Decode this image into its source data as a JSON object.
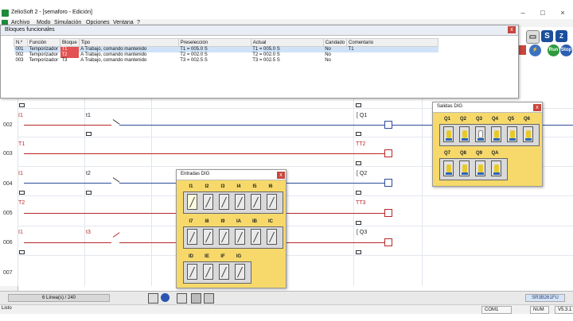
{
  "window": {
    "title": "ZelioSoft 2 - [semaforo - Edición]",
    "min": "–",
    "max": "□",
    "close": "×"
  },
  "menu": [
    "Archivo",
    "Modo",
    "Simulación",
    "Opciones",
    "Ventana",
    "?"
  ],
  "toolbar": {
    "s_btn": "S",
    "run": "Run",
    "stop": "Stop",
    "left_tab": "inte",
    "left_tab2": "Ne"
  },
  "fb": {
    "title": "Bloques funcionales",
    "close": "x",
    "columns": [
      "N.º",
      "Función",
      "Bloque",
      "Tipo",
      "Preselección",
      "Actual",
      "Candado",
      "Comentario"
    ],
    "rows": [
      [
        "001",
        "Temporizador",
        "T1",
        "A",
        "Trabajo, comando mantenido",
        "T1 = 005.0 S",
        "T1 = 005.0 S",
        "No",
        "T1"
      ],
      [
        "002",
        "Temporizador",
        "T2",
        "A",
        "Trabajo, comando mantenido",
        "T2 = 002.0 S",
        "T2 = 002.0 S",
        "No",
        ""
      ],
      [
        "003",
        "Temporizador",
        "T3",
        "A",
        "Trabajo, comando mantenido",
        "T3 = 002.5 S",
        "T3 = 002.5 S",
        "No",
        ""
      ]
    ]
  },
  "rows": [
    "001",
    "002",
    "003",
    "004",
    "005",
    "006",
    "007"
  ],
  "ladder": {
    "i1a": "I1",
    "t1": "t1",
    "q1": "[ Q1",
    "t1b": "T1",
    "tt2": "TT2",
    "i1b": "I1",
    "t2": "t2",
    "q2": "[ Q2",
    "t2b": "T2",
    "tt3": "TT3",
    "i1c": "I1",
    "t3": "t3",
    "q3": "[ Q3"
  },
  "entradas": {
    "title": "Entradas DIG",
    "close": "x",
    "row1": [
      "I1",
      "I2",
      "I3",
      "I4",
      "I5",
      "I6"
    ],
    "row2": [
      "I7",
      "I8",
      "I9",
      "IA",
      "IB",
      "IC"
    ],
    "row3": [
      "ID",
      "IE",
      "IF",
      "IG"
    ]
  },
  "salidas": {
    "title": "Salidas DIG",
    "close": "x",
    "row1": [
      "Q1",
      "Q2",
      "Q3",
      "Q4",
      "Q5",
      "Q6"
    ],
    "row2": [
      "Q7",
      "Q8",
      "Q9",
      "QA"
    ],
    "lit_index": 2
  },
  "bottom": {
    "lines": "6 Línea(s) / 240",
    "device": "SR3B261FU"
  },
  "status": {
    "text": "Listo",
    "port": "COM1",
    "num": "NUM",
    "version": "V5.3.1"
  },
  "colors": {
    "accent_red": "#b62828",
    "coil_blue": "#2d4c9a",
    "panel_yellow": "#f6d96a"
  }
}
